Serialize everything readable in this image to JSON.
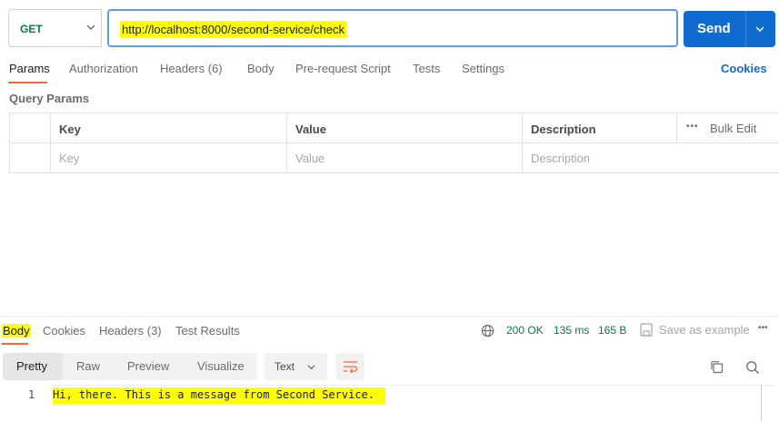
{
  "request": {
    "method": "GET",
    "url": "http://localhost:8000/second-service/check",
    "send_label": "Send"
  },
  "request_tabs": {
    "params": "Params",
    "authorization": "Authorization",
    "headers": "Headers (6)",
    "body": "Body",
    "pre_request_script": "Pre-request Script",
    "tests": "Tests",
    "settings": "Settings",
    "cookies": "Cookies"
  },
  "query_params": {
    "title": "Query Params",
    "columns": {
      "key": "Key",
      "value": "Value",
      "description": "Description"
    },
    "more": "•••",
    "bulk_edit": "Bulk Edit",
    "placeholders": {
      "key": "Key",
      "value": "Value",
      "description": "Description"
    }
  },
  "response_tabs": {
    "body": "Body",
    "cookies": "Cookies",
    "headers": "Headers (3)",
    "test_results": "Test Results"
  },
  "response_meta": {
    "status": "200 OK",
    "time": "135 ms",
    "size": "165 B",
    "save_example": "Save as example"
  },
  "view_modes": {
    "pretty": "Pretty",
    "raw": "Raw",
    "preview": "Preview",
    "visualize": "Visualize",
    "format": "Text"
  },
  "response_body": {
    "line_number": "1",
    "text": "Hi, there. This is a message from Second Service."
  },
  "colors": {
    "accent": "#0f6bcf",
    "active_tab": "#f26b3a",
    "success": "#0b7a48",
    "highlight": "#ffff00"
  }
}
